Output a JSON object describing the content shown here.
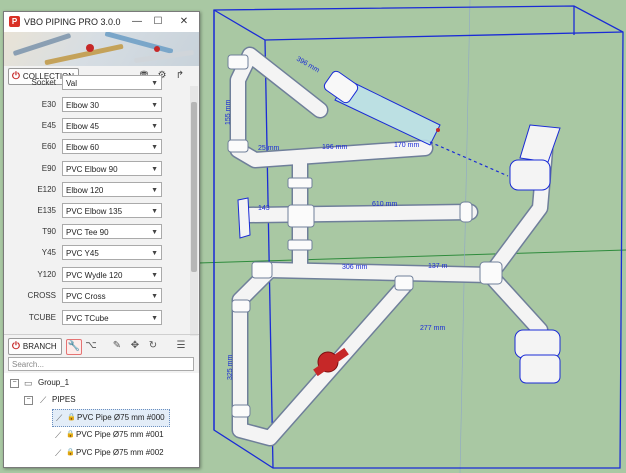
{
  "window": {
    "title": "VBO PIPING PRO 3.0.0",
    "minimize": "—",
    "maximize": "☐",
    "close": "✕"
  },
  "collection_button": "COLLECTION",
  "fittings": [
    {
      "label": "Socket",
      "value": "Val"
    },
    {
      "label": "E30",
      "value": "Elbow 30"
    },
    {
      "label": "E45",
      "value": "Elbow 45"
    },
    {
      "label": "E60",
      "value": "Elbow 60"
    },
    {
      "label": "E90",
      "value": "PVC Elbow 90"
    },
    {
      "label": "E120",
      "value": "Elbow 120"
    },
    {
      "label": "E135",
      "value": "PVC Elbow 135"
    },
    {
      "label": "T90",
      "value": "PVC Tee 90"
    },
    {
      "label": "Y45",
      "value": "PVC Y45"
    },
    {
      "label": "Y120",
      "value": "PVC Wydle 120"
    },
    {
      "label": "CROSS",
      "value": "PVC Cross"
    },
    {
      "label": "TCUBE",
      "value": "PVC TCube"
    }
  ],
  "branch_button": "BRANCH",
  "search": {
    "placeholder": "Search..."
  },
  "tree": {
    "group": "Group_1",
    "pipes": "PIPES",
    "items": [
      "PVC Pipe Ø75 mm #000",
      "PVC Pipe Ø75 mm #001",
      "PVC Pipe Ø75 mm #002"
    ]
  },
  "dimensions": [
    "396 mm",
    "196 mm",
    "170 mm",
    "25 mm",
    "143",
    "610 mm",
    "306 mm",
    "137 m",
    "155 mm",
    "325 mm",
    "277 mm"
  ],
  "colors": {
    "accent_red": "#c62828",
    "bbox_blue": "#1a2bd6",
    "ground": "#a9c8a3",
    "pipe": "#f4f4f4"
  }
}
